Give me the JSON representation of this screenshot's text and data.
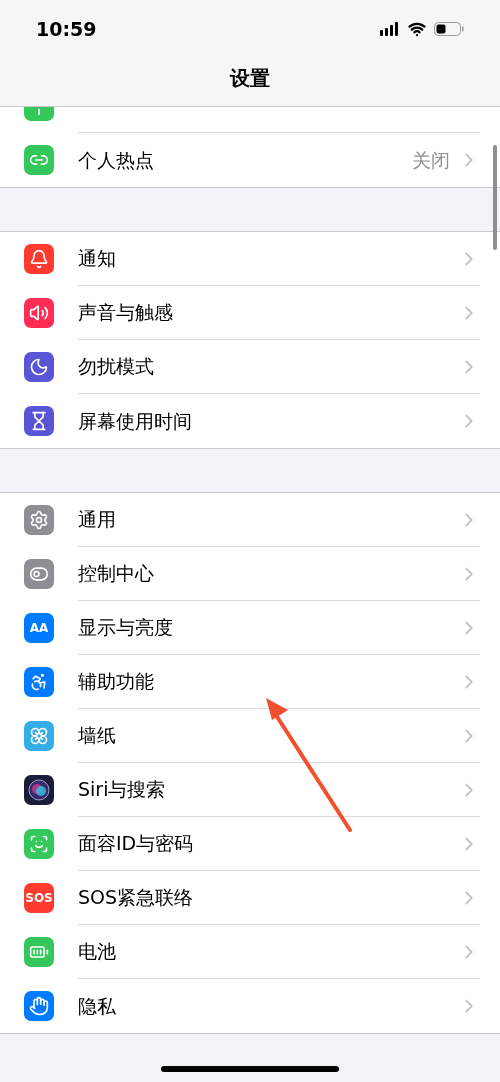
{
  "status_bar": {
    "time": "10:59"
  },
  "title": "设置",
  "groups": [
    {
      "items": [
        {
          "cut_off": true
        },
        {
          "label": "个人热点",
          "value": "关闭"
        }
      ]
    },
    {
      "items": [
        {
          "label": "通知"
        },
        {
          "label": "声音与触感"
        },
        {
          "label": "勿扰模式"
        },
        {
          "label": "屏幕使用时间"
        }
      ]
    },
    {
      "items": [
        {
          "label": "通用"
        },
        {
          "label": "控制中心"
        },
        {
          "label": "显示与亮度",
          "icon_text": "AA"
        },
        {
          "label": "辅助功能"
        },
        {
          "label": "墙纸"
        },
        {
          "label": "Siri与搜索"
        },
        {
          "label": "面容ID与密码"
        },
        {
          "label": "SOS紧急联络",
          "icon_text": "SOS"
        },
        {
          "label": "电池"
        },
        {
          "label": "隐私"
        }
      ]
    }
  ]
}
